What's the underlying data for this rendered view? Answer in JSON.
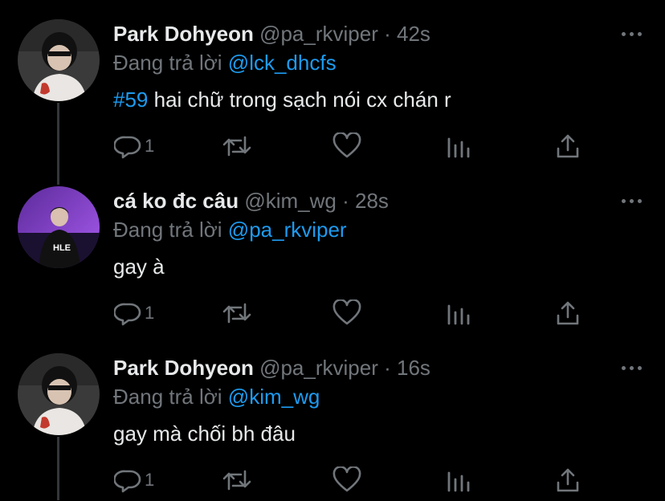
{
  "tweets": [
    {
      "name": "Park Dohyeon",
      "handle": "@pa_rkviper",
      "dot": "·",
      "time": "42s",
      "reply_prefix": "Đang trả lời",
      "reply_to": "@lck_dhcfs",
      "hashtag": "#59",
      "text": "hai chữ trong sạch nói cx chán r",
      "reply_count": "1",
      "avatar": "avatar-park-dohyeon"
    },
    {
      "name": "cá ko đc câu",
      "handle": "@kim_wg",
      "dot": "·",
      "time": "28s",
      "reply_prefix": "Đang trả lời",
      "reply_to": "@pa_rkviper",
      "hashtag": "",
      "text": "gay à",
      "reply_count": "1",
      "avatar": "avatar-hle-player"
    },
    {
      "name": "Park Dohyeon",
      "handle": "@pa_rkviper",
      "dot": "·",
      "time": "16s",
      "reply_prefix": "Đang trả lời",
      "reply_to": "@kim_wg",
      "hashtag": "",
      "text": "gay mà chối bh đâu",
      "reply_count": "1",
      "avatar": "avatar-park-dohyeon"
    }
  ],
  "colors": {
    "background": "#000000",
    "text": "#e7e9ea",
    "muted": "#71767b",
    "accent": "#1d9bf0",
    "thread_line": "#333639"
  },
  "icons": [
    "reply-icon",
    "retweet-icon",
    "like-icon",
    "analytics-icon",
    "share-icon",
    "more-icon"
  ]
}
